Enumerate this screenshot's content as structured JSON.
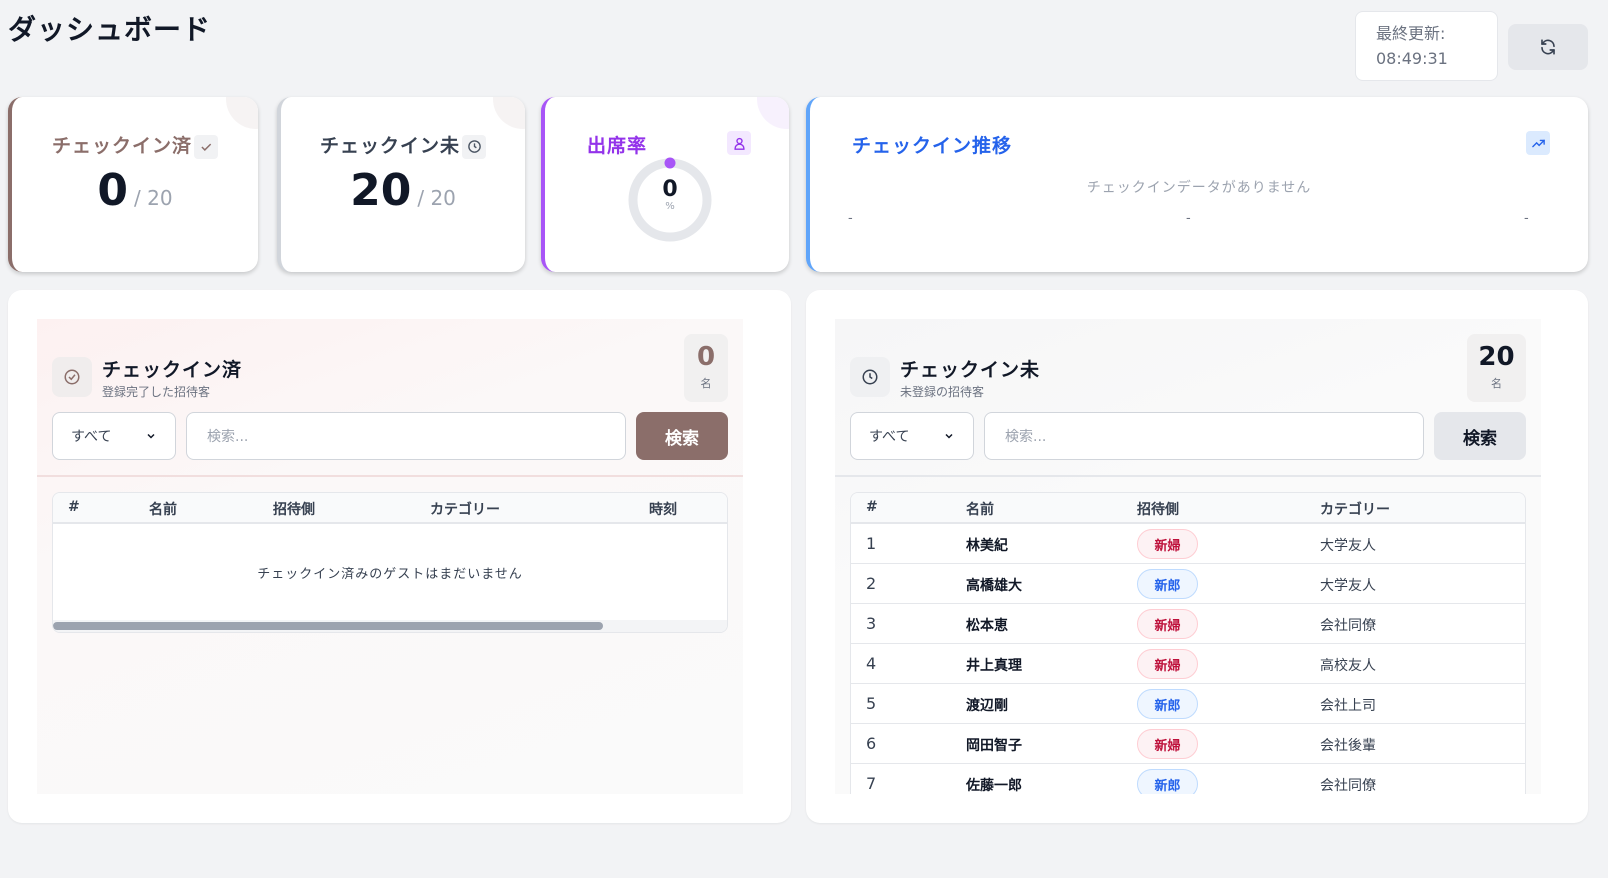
{
  "header": {
    "title": "ダッシュボード",
    "last_updated_label": "最終更新:",
    "last_updated_time": "08:49:31"
  },
  "stats": {
    "checked_in": {
      "label": "チェックイン済",
      "value": "0",
      "total": "/ 20"
    },
    "not_checked_in": {
      "label": "チェックイン未",
      "value": "20",
      "total": "/ 20"
    },
    "attendance": {
      "label": "出席率",
      "value": "0",
      "unit": "%"
    },
    "trend": {
      "title": "チェックイン推移",
      "empty": "チェックインデータがありません",
      "ticks": [
        "-",
        "-",
        "-"
      ]
    }
  },
  "checked_panel": {
    "title": "チェックイン済",
    "subtitle": "登録完了した招待客",
    "count": "0",
    "count_unit": "名",
    "filter_value": "すべて",
    "search_placeholder": "検索...",
    "search_button": "検索",
    "columns": [
      "#",
      "名前",
      "招待側",
      "カテゴリー",
      "時刻"
    ],
    "empty_message": "チェックイン済みのゲストはまだいません"
  },
  "unchecked_panel": {
    "title": "チェックイン未",
    "subtitle": "未登録の招待客",
    "count": "20",
    "count_unit": "名",
    "filter_value": "すべて",
    "search_placeholder": "検索...",
    "search_button": "検索",
    "columns": [
      "#",
      "名前",
      "招待側",
      "カテゴリー"
    ],
    "rows": [
      {
        "no": "1",
        "name": "林美紀",
        "side": "新婦",
        "category": "大学友人"
      },
      {
        "no": "2",
        "name": "高橋雄大",
        "side": "新郎",
        "category": "大学友人"
      },
      {
        "no": "3",
        "name": "松本恵",
        "side": "新婦",
        "category": "会社同僚"
      },
      {
        "no": "4",
        "name": "井上真理",
        "side": "新婦",
        "category": "高校友人"
      },
      {
        "no": "5",
        "name": "渡辺剛",
        "side": "新郎",
        "category": "会社上司"
      },
      {
        "no": "6",
        "name": "岡田智子",
        "side": "新婦",
        "category": "会社後輩"
      },
      {
        "no": "7",
        "name": "佐藤一郎",
        "side": "新郎",
        "category": "会社同僚"
      }
    ]
  },
  "colors": {
    "brown": "#8b6e6a",
    "purple": "#a855f7",
    "blue": "#60a5fa",
    "bride": "#be123c",
    "groom": "#2563eb"
  },
  "icons": [
    "refresh-icon",
    "check-icon",
    "clock-icon",
    "user-icon",
    "trend-icon",
    "check-circle-icon",
    "chevron-down-icon"
  ]
}
